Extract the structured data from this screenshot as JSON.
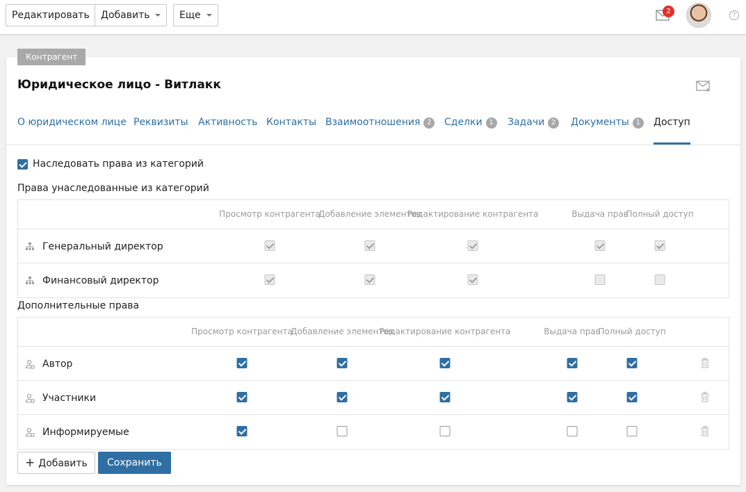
{
  "toolbar": {
    "edit_label": "Редактировать",
    "add_label": "Добавить",
    "more_label": "Еще",
    "mail_badge": "2"
  },
  "card": {
    "tag": "Контрагент",
    "title": "Юридическое лицо - Витлакк"
  },
  "tabs": [
    {
      "label": "О юридическом лице",
      "count": ""
    },
    {
      "label": "Реквизиты",
      "count": ""
    },
    {
      "label": "Активность",
      "count": ""
    },
    {
      "label": "Контакты",
      "count": ""
    },
    {
      "label": "Взаимоотношения",
      "count": "2"
    },
    {
      "label": "Сделки",
      "count": "1"
    },
    {
      "label": "Задачи",
      "count": "2"
    },
    {
      "label": "Документы",
      "count": "1"
    },
    {
      "label": "Доступ",
      "count": "",
      "active": true
    }
  ],
  "access": {
    "inherit_label": "Наследовать права из категорий",
    "inherit_checked": true,
    "inherited_title": "Права унаследованные из категорий",
    "additional_title": "Дополнительные права",
    "columns": [
      "Просмотр контрагента",
      "Добавление элементов",
      "Редактирование контрагента",
      "Выдача прав",
      "Полный доступ"
    ],
    "inherited_rows": [
      {
        "name": "Генеральный директор",
        "icon": "org-structure-icon",
        "perms": [
          true,
          true,
          true,
          true,
          true
        ]
      },
      {
        "name": "Финансовый директор",
        "icon": "org-structure-icon",
        "perms": [
          true,
          true,
          true,
          false,
          false
        ]
      }
    ],
    "additional_rows": [
      {
        "name": "Автор",
        "icon": "user-icon",
        "perms": [
          true,
          true,
          true,
          true,
          true
        ]
      },
      {
        "name": "Участники",
        "icon": "user-icon",
        "perms": [
          true,
          true,
          true,
          true,
          true
        ]
      },
      {
        "name": "Информируемые",
        "icon": "user-icon",
        "perms": [
          true,
          false,
          false,
          false,
          false
        ]
      }
    ]
  },
  "actions": {
    "add_label": "Добавить",
    "save_label": "Сохранить"
  },
  "colors": {
    "accent": "#2f6fa4",
    "badge": "#e0322d",
    "tag": "#a9a9a9"
  }
}
